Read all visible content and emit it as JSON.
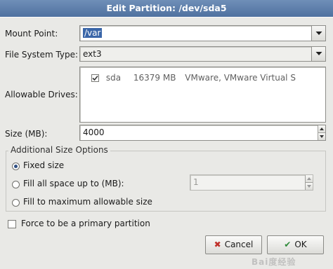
{
  "window": {
    "title": "Edit Partition: /dev/sda5"
  },
  "mount_point": {
    "label": "Mount Point:",
    "value": "/var"
  },
  "fs_type": {
    "label": "File System Type:",
    "value": "ext3"
  },
  "drives": {
    "label": "Allowable Drives:",
    "rows": [
      {
        "checked": true,
        "name": "sda",
        "size": "16379 MB",
        "model": "VMware, VMware Virtual S"
      }
    ]
  },
  "size": {
    "label": "Size (MB):",
    "value": "4000"
  },
  "size_options": {
    "title": "Additional Size Options",
    "fixed": {
      "label": "Fixed size",
      "selected": true
    },
    "fill_up_to": {
      "label": "Fill all space up to (MB):",
      "selected": false,
      "value": "1"
    },
    "fill_max": {
      "label": "Fill to maximum allowable size",
      "selected": false
    }
  },
  "primary": {
    "label": "Force to be a primary partition",
    "checked": false
  },
  "buttons": {
    "cancel": "Cancel",
    "ok": "OK"
  },
  "watermark": "Bai度经验",
  "icons": {
    "cancel": "cancel-x-icon",
    "ok": "ok-check-icon",
    "combo": "chevron-down-icon"
  },
  "colors": {
    "title_bar": "#5b7cab",
    "selection": "#3a66a8",
    "cancel_icon": "#c0302a",
    "ok_icon": "#2f8a3a"
  }
}
